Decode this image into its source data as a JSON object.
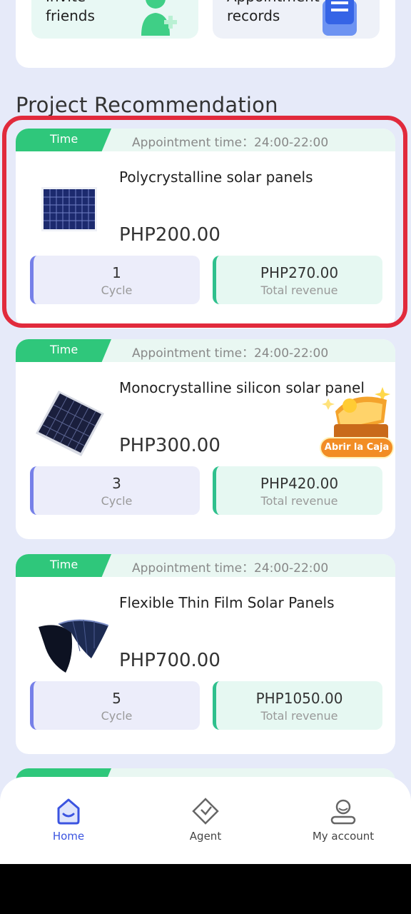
{
  "quick_actions": [
    {
      "label": "Invite friends",
      "icon": "person-add-icon"
    },
    {
      "label": "Appointment records",
      "icon": "clipboard-icon"
    }
  ],
  "section_title": "Project Recommendation",
  "products": [
    {
      "tag": "Time",
      "appointment": "Appointment time：24:00-22:00",
      "name": "Polycrystalline solar panels",
      "price": "PHP200.00",
      "cycle_value": "1",
      "cycle_label": "Cycle",
      "revenue_value": "PHP270.00",
      "revenue_label": "Total revenue",
      "image": "polycrystalline-panel-image"
    },
    {
      "tag": "Time",
      "appointment": "Appointment time：24:00-22:00",
      "name": "Monocrystalline silicon solar panel",
      "price": "PHP300.00",
      "cycle_value": "3",
      "cycle_label": "Cycle",
      "revenue_value": "PHP420.00",
      "revenue_label": "Total revenue",
      "image": "monocrystalline-panel-image"
    },
    {
      "tag": "Time",
      "appointment": "Appointment time：24:00-22:00",
      "name": "Flexible Thin Film Solar Panels",
      "price": "PHP700.00",
      "cycle_value": "5",
      "cycle_label": "Cycle",
      "revenue_value": "PHP1050.00",
      "revenue_label": "Total revenue",
      "image": "flexible-panel-image"
    }
  ],
  "promo": {
    "label": "Abrir la Caja"
  },
  "nav": [
    {
      "label": "Home",
      "icon": "home-icon",
      "active": true
    },
    {
      "label": "Agent",
      "icon": "agent-icon",
      "active": false
    },
    {
      "label": "My account",
      "icon": "account-icon",
      "active": false
    }
  ],
  "colors": {
    "accent_green": "#2fc77b",
    "highlight_red": "#e12a3c",
    "nav_active": "#3b54e0",
    "background": "#e6eaf9"
  }
}
